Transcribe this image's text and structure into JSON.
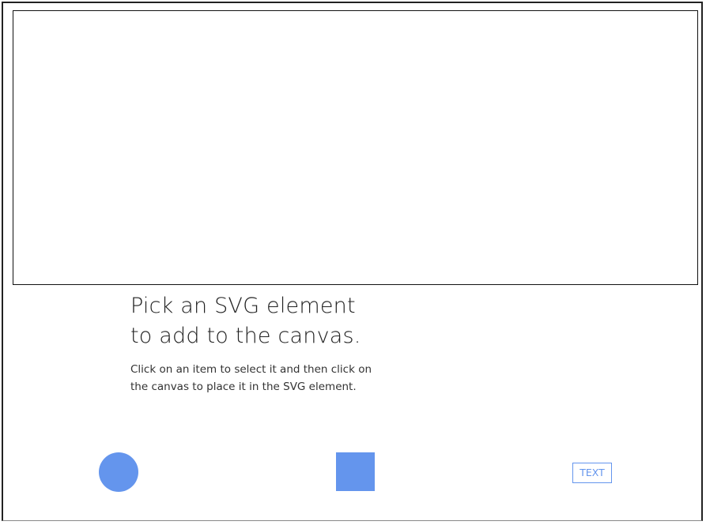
{
  "instructions": {
    "heading_line1": "Pick an SVG element",
    "heading_line2": "to add to the canvas.",
    "desc_line1": "Click on an item to select it and then click on",
    "desc_line2": "the canvas to place it in the SVG element."
  },
  "palette": {
    "items": [
      {
        "name": "circle",
        "label": ""
      },
      {
        "name": "square",
        "label": ""
      },
      {
        "name": "text",
        "label": "TEXT"
      }
    ]
  },
  "colors": {
    "accent": "#6495ed",
    "border": "#111111"
  }
}
